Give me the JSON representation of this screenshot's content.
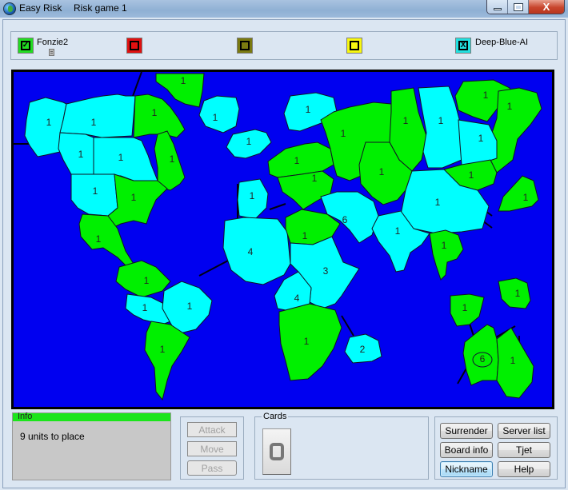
{
  "window": {
    "app_title": "Easy Risk",
    "game_title": "Risk game 1",
    "controls": {
      "minimize": "—",
      "maximize": "□",
      "close": "X"
    }
  },
  "players": [
    {
      "name": "Fonzie2",
      "color": "#22dd22",
      "mark": "✓",
      "has_cards": true
    },
    {
      "name": "",
      "color": "#e01010",
      "mark": "",
      "has_cards": false
    },
    {
      "name": "",
      "color": "#7a7a10",
      "mark": "",
      "has_cards": false
    },
    {
      "name": "",
      "color": "#f8f810",
      "mark": "",
      "has_cards": false
    },
    {
      "name": "Deep-Blue-AI",
      "color": "#22e0e0",
      "mark": "X",
      "has_cards": false
    }
  ],
  "colors": {
    "ocean": "#0000f0",
    "player_green": "#00f000",
    "player_cyan": "#00ffff"
  },
  "territories": [
    {
      "name": "greenland",
      "owner": "green",
      "armies": "1"
    },
    {
      "name": "alaska",
      "owner": "cyan",
      "armies": "1"
    },
    {
      "name": "northwest-territory",
      "owner": "cyan",
      "armies": "1"
    },
    {
      "name": "quebec-north",
      "owner": "green",
      "armies": "1"
    },
    {
      "name": "alberta",
      "owner": "cyan",
      "armies": "1"
    },
    {
      "name": "ontario",
      "owner": "cyan",
      "armies": "1"
    },
    {
      "name": "eastern-canada",
      "owner": "green",
      "armies": "1"
    },
    {
      "name": "western-us",
      "owner": "cyan",
      "armies": "1"
    },
    {
      "name": "eastern-us",
      "owner": "green",
      "armies": "1"
    },
    {
      "name": "central-america",
      "owner": "green",
      "armies": "1"
    },
    {
      "name": "venezuela",
      "owner": "green",
      "armies": "1"
    },
    {
      "name": "peru",
      "owner": "cyan",
      "armies": "1"
    },
    {
      "name": "brazil",
      "owner": "cyan",
      "armies": "1"
    },
    {
      "name": "argentina",
      "owner": "green",
      "armies": "1"
    },
    {
      "name": "iceland",
      "owner": "cyan",
      "armies": "1"
    },
    {
      "name": "scandinavia",
      "owner": "cyan",
      "armies": "1"
    },
    {
      "name": "great-britain",
      "owner": "cyan",
      "armies": "1"
    },
    {
      "name": "northern-europe",
      "owner": "green",
      "armies": "1"
    },
    {
      "name": "western-europe",
      "owner": "cyan",
      "armies": "1"
    },
    {
      "name": "southern-europe",
      "owner": "green",
      "armies": "1"
    },
    {
      "name": "ukraine",
      "owner": "green",
      "armies": "1"
    },
    {
      "name": "north-africa",
      "owner": "cyan",
      "armies": "4"
    },
    {
      "name": "egypt",
      "owner": "green",
      "armies": "1"
    },
    {
      "name": "east-africa",
      "owner": "cyan",
      "armies": "3"
    },
    {
      "name": "congo",
      "owner": "cyan",
      "armies": "4"
    },
    {
      "name": "south-africa",
      "owner": "green",
      "armies": "1"
    },
    {
      "name": "madagascar",
      "owner": "cyan",
      "armies": "2"
    },
    {
      "name": "middle-east",
      "owner": "cyan",
      "armies": "6"
    },
    {
      "name": "ural",
      "owner": "green",
      "armies": "1"
    },
    {
      "name": "siberia",
      "owner": "cyan",
      "armies": "1"
    },
    {
      "name": "yakutsk",
      "owner": "green",
      "armies": "1"
    },
    {
      "name": "kamchatka",
      "owner": "green",
      "armies": "1"
    },
    {
      "name": "irkutsk",
      "owner": "cyan",
      "armies": "1"
    },
    {
      "name": "afghanistan",
      "owner": "green",
      "armies": "1"
    },
    {
      "name": "mongolia",
      "owner": "green",
      "armies": "1"
    },
    {
      "name": "japan",
      "owner": "green",
      "armies": "1"
    },
    {
      "name": "china",
      "owner": "cyan",
      "armies": "1"
    },
    {
      "name": "india",
      "owner": "cyan",
      "armies": "1"
    },
    {
      "name": "siam",
      "owner": "green",
      "armies": "1"
    },
    {
      "name": "indonesia",
      "owner": "green",
      "armies": "1"
    },
    {
      "name": "new-guinea",
      "owner": "green",
      "armies": "1"
    },
    {
      "name": "western-australia",
      "owner": "green",
      "armies": "6",
      "selected": true
    },
    {
      "name": "eastern-australia",
      "owner": "green",
      "armies": "1"
    }
  ],
  "info": {
    "legend": "Info",
    "message": "9 units to place"
  },
  "actions": {
    "attack": "Attack",
    "move": "Move",
    "pass": "Pass"
  },
  "cards": {
    "legend": "Cards"
  },
  "menu": {
    "surrender": "Surrender",
    "server_list": "Server list",
    "board_info": "Board info",
    "tjet": "Tjet",
    "nickname": "Nickname",
    "help": "Help"
  }
}
